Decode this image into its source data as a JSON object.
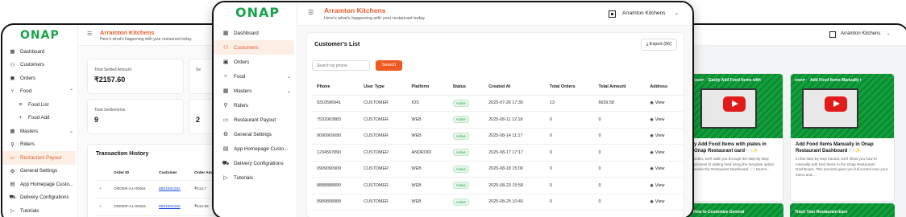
{
  "brand": "ONAP",
  "restaurant_name": "Arramton Kitchens",
  "header_subtitle": "Here's what's happening with your restaurant today.",
  "restaurant_selector": "Arramton Kitchens",
  "left_sidebar": {
    "items": [
      {
        "label": "Dashboard",
        "icon": "grid-icon"
      },
      {
        "label": "Customers",
        "icon": "user-icon"
      },
      {
        "label": "Orders",
        "icon": "box-icon"
      },
      {
        "label": "Food",
        "icon": "utensils-icon"
      },
      {
        "label": "Food List",
        "icon": "list-icon"
      },
      {
        "label": "Food Add",
        "icon": "plus-icon"
      },
      {
        "label": "Masters",
        "icon": "grid-icon"
      },
      {
        "label": "Riders",
        "icon": "rider-icon"
      },
      {
        "label": "Restaurant Payout",
        "icon": "card-icon"
      },
      {
        "label": "General Settings",
        "icon": "gear-icon"
      },
      {
        "label": "App Homepage Custo...",
        "icon": "layout-icon"
      },
      {
        "label": "Delivery Configrations",
        "icon": "truck-icon"
      },
      {
        "label": "Tutorials",
        "icon": "play-icon"
      }
    ]
  },
  "left_main": {
    "stat_cards": [
      {
        "label": "Total Settled Amount",
        "value": "₹2157.60"
      },
      {
        "label": "Total Settlements",
        "value": "9"
      },
      {
        "label": "Se",
        "value": ""
      },
      {
        "label": "",
        "value": "2"
      }
    ],
    "transaction_history": {
      "title": "Transaction History",
      "columns": [
        "",
        "Order ID",
        "Customer",
        "Order Am"
      ],
      "rows": [
        {
          "expand": "+",
          "order_id": "ORDER-A1-00064",
          "customer": "8851581282",
          "amount": "₹614.7"
        },
        {
          "expand": "+",
          "order_id": "ORDER-A1-00063",
          "customer": "8851581282",
          "amount": "₹614.99"
        }
      ]
    }
  },
  "center_sidebar": {
    "items": [
      {
        "label": "Dashboard",
        "icon": "grid-icon",
        "active": false,
        "chev": false
      },
      {
        "label": "Customers",
        "icon": "user-icon",
        "active": true,
        "chev": false
      },
      {
        "label": "Orders",
        "icon": "box-icon",
        "active": false,
        "chev": false
      },
      {
        "label": "Food",
        "icon": "utensils-icon",
        "active": false,
        "chev": true
      },
      {
        "label": "Masters",
        "icon": "grid-icon",
        "active": false,
        "chev": true
      },
      {
        "label": "Riders",
        "icon": "rider-icon",
        "active": false,
        "chev": false
      },
      {
        "label": "Restaurant Payout",
        "icon": "card-icon",
        "active": false,
        "chev": false
      },
      {
        "label": "General Settings",
        "icon": "gear-icon",
        "active": false,
        "chev": false
      },
      {
        "label": "App Homepage Custo...",
        "icon": "layout-icon",
        "active": false,
        "chev": false
      },
      {
        "label": "Delivery Configrations",
        "icon": "truck-icon",
        "active": false,
        "chev": false
      },
      {
        "label": "Tutorials",
        "icon": "play-icon",
        "active": false,
        "chev": false
      }
    ]
  },
  "customers": {
    "title": "Customer's List",
    "export_label": "Export (56)",
    "search_placeholder": "Search by phone",
    "search_button": "Search",
    "columns": [
      "Phone",
      "User Type",
      "Platform",
      "Status",
      "Created At",
      "Total Orders",
      "Total Amount",
      "Address"
    ],
    "view_label": "View",
    "rows": [
      {
        "phone": "9310596941",
        "user_type": "CUSTOMER",
        "platform": "IOS",
        "status": "Active",
        "created_at": "2025-07-26 17:30",
        "total_orders": "13",
        "total_amount": "6639.58"
      },
      {
        "phone": "7532063883",
        "user_type": "CUSTOMER",
        "platform": "WEB",
        "status": "Active",
        "created_at": "2025-08-11 12:18",
        "total_orders": "0",
        "total_amount": "0"
      },
      {
        "phone": "9090909090",
        "user_type": "CUSTOMER",
        "platform": "WEB",
        "status": "Active",
        "created_at": "2025-08-14 11:17",
        "total_orders": "0",
        "total_amount": "0"
      },
      {
        "phone": "1234567890",
        "user_type": "CUSTOMER",
        "platform": "ANDROID",
        "status": "Active",
        "created_at": "2025-08-17 17:17",
        "total_orders": "0",
        "total_amount": "0"
      },
      {
        "phone": "0909090909",
        "user_type": "CUSTOMER",
        "platform": "WEB",
        "status": "Active",
        "created_at": "2025-08-18 15:00",
        "total_orders": "0",
        "total_amount": "0"
      },
      {
        "phone": "8888888890",
        "user_type": "CUSTOMER",
        "platform": "WEB",
        "status": "Active",
        "created_at": "2025-08-23 15:58",
        "total_orders": "0",
        "total_amount": "0"
      },
      {
        "phone": "9989898989",
        "user_type": "CUSTOMER",
        "platform": "WEB",
        "status": "Active",
        "created_at": "2025-08-25 10:40",
        "total_orders": "0",
        "total_amount": "0"
      }
    ]
  },
  "tutorials": {
    "cards": [
      {
        "thumb_brand": "ONAP",
        "thumb_title": "Easily Add Food Items with",
        "title": "y Add Food Items with plates in Onap Restaurant oard 🍽️✨",
        "desc": "video, we'll walk you through the step-by-step process of adding food using the template option inside the Restaurant Dashboard. 🍽️ Here's..."
      },
      {
        "thumb_brand": "ONAP",
        "thumb_title": "Add Food Items Manually i",
        "title": "Add Food Items Manually in Onap Restaurant Dashboard 🍽️✨",
        "desc": "In this step-by-step tutorial, we'll show you how to manually add food items in the Onap Restaurant Dashboard. This process gives you full control over your menu and..."
      }
    ],
    "bottom_titles": [
      "How to Customize General",
      "Track Your Restaurant Earn"
    ]
  },
  "colors": {
    "brand_green": "#18a34a",
    "accent_orange": "#e85d2c",
    "button_orange": "#f05a22"
  }
}
